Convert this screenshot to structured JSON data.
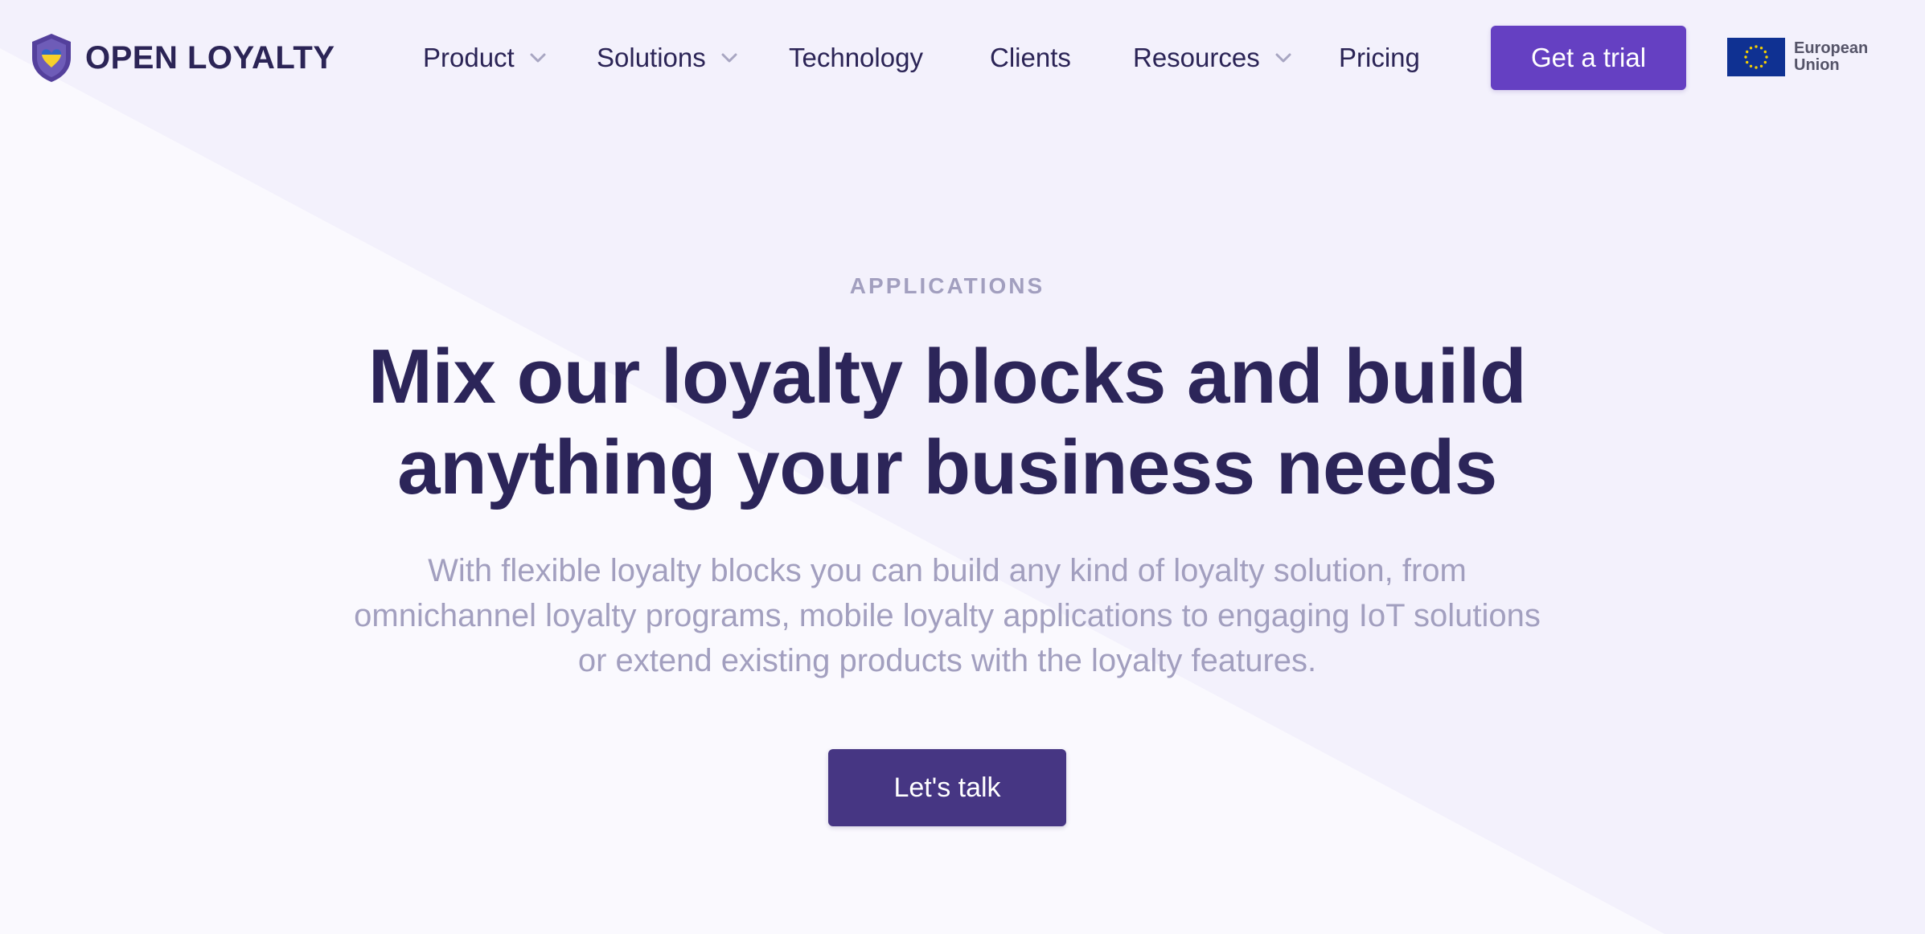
{
  "brand": {
    "name": "OPEN LOYALTY",
    "logo_icon": "heart-shield-icon"
  },
  "nav": {
    "items": [
      {
        "label": "Product",
        "has_dropdown": true
      },
      {
        "label": "Solutions",
        "has_dropdown": true
      },
      {
        "label": "Technology",
        "has_dropdown": false
      },
      {
        "label": "Clients",
        "has_dropdown": false
      },
      {
        "label": "Resources",
        "has_dropdown": true
      },
      {
        "label": "Pricing",
        "has_dropdown": false
      }
    ],
    "cta_label": "Get a trial"
  },
  "eu_badge": {
    "line1": "European",
    "line2": "Union",
    "icon": "eu-flag-icon"
  },
  "hero": {
    "eyebrow": "APPLICATIONS",
    "headline_line1": "Mix our loyalty blocks and build",
    "headline_line2": "anything your business needs",
    "subtext": "With flexible loyalty blocks you can build any kind of loyalty solution, from omnichannel loyalty programs, mobile loyalty applications to engaging IoT solutions or extend existing products with the loyalty features.",
    "cta_label": "Let's talk"
  },
  "colors": {
    "brand_purple": "#6540c2",
    "dark_purple_button": "#463683",
    "heading": "#2c2559",
    "muted_text": "#a29fbf",
    "background": "#f5f3fd",
    "eu_blue": "#0f3192",
    "eu_star": "#f5d000",
    "shield_border": "#54409c",
    "heart_blue": "#2f66c6",
    "heart_yellow": "#f6d02b"
  }
}
